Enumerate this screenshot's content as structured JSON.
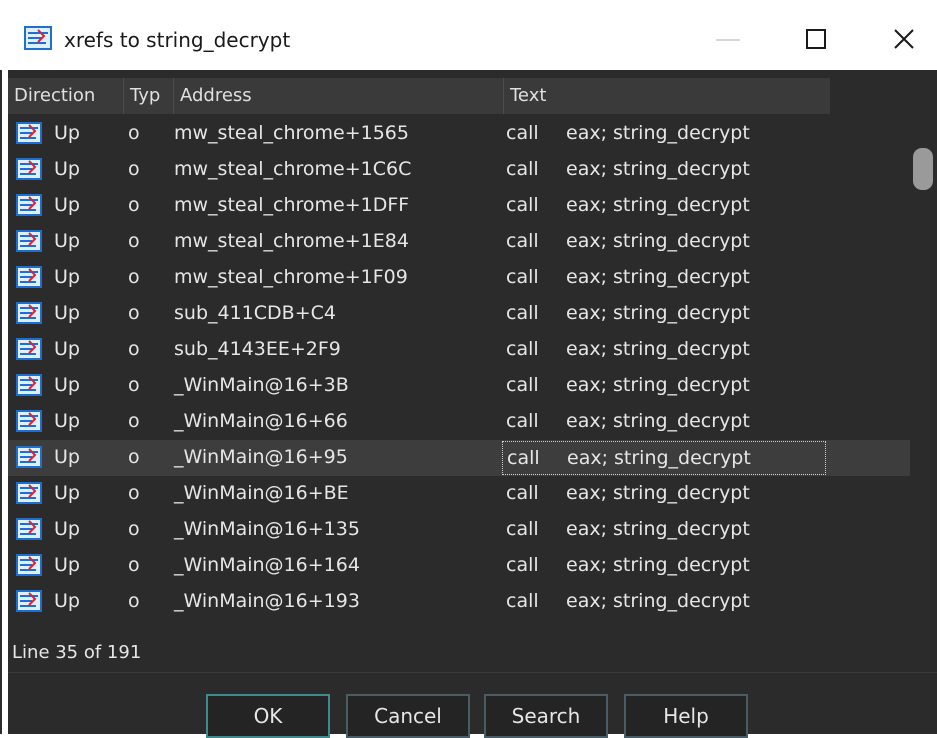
{
  "window": {
    "title": "xrefs to string_decrypt"
  },
  "columns": {
    "direction": "Direction",
    "type": "Typ",
    "address": "Address",
    "text": "Text"
  },
  "rows": [
    {
      "direction": "Up",
      "type": "o",
      "address": "mw_steal_chrome+1565",
      "mnemonic": "call",
      "operand": "eax; string_decrypt"
    },
    {
      "direction": "Up",
      "type": "o",
      "address": "mw_steal_chrome+1C6C",
      "mnemonic": "call",
      "operand": "eax; string_decrypt"
    },
    {
      "direction": "Up",
      "type": "o",
      "address": "mw_steal_chrome+1DFF",
      "mnemonic": "call",
      "operand": "eax; string_decrypt"
    },
    {
      "direction": "Up",
      "type": "o",
      "address": "mw_steal_chrome+1E84",
      "mnemonic": "call",
      "operand": "eax; string_decrypt"
    },
    {
      "direction": "Up",
      "type": "o",
      "address": "mw_steal_chrome+1F09",
      "mnemonic": "call",
      "operand": "eax; string_decrypt"
    },
    {
      "direction": "Up",
      "type": "o",
      "address": "sub_411CDB+C4",
      "mnemonic": "call",
      "operand": "eax; string_decrypt"
    },
    {
      "direction": "Up",
      "type": "o",
      "address": "sub_4143EE+2F9",
      "mnemonic": "call",
      "operand": "eax; string_decrypt"
    },
    {
      "direction": "Up",
      "type": "o",
      "address": "_WinMain@16+3B",
      "mnemonic": "call",
      "operand": "eax; string_decrypt"
    },
    {
      "direction": "Up",
      "type": "o",
      "address": "_WinMain@16+66",
      "mnemonic": "call",
      "operand": "eax; string_decrypt"
    },
    {
      "direction": "Up",
      "type": "o",
      "address": "_WinMain@16+95",
      "mnemonic": "call",
      "operand": "eax; string_decrypt",
      "selected": true
    },
    {
      "direction": "Up",
      "type": "o",
      "address": "_WinMain@16+BE",
      "mnemonic": "call",
      "operand": "eax; string_decrypt"
    },
    {
      "direction": "Up",
      "type": "o",
      "address": "_WinMain@16+135",
      "mnemonic": "call",
      "operand": "eax; string_decrypt"
    },
    {
      "direction": "Up",
      "type": "o",
      "address": "_WinMain@16+164",
      "mnemonic": "call",
      "operand": "eax; string_decrypt"
    },
    {
      "direction": "Up",
      "type": "o",
      "address": "_WinMain@16+193",
      "mnemonic": "call",
      "operand": "eax; string_decrypt"
    }
  ],
  "status": {
    "text": "Line 35 of 191"
  },
  "buttons": {
    "ok": "OK",
    "cancel": "Cancel",
    "search": "Search",
    "help": "Help"
  },
  "colors": {
    "background": "#2b2b2b",
    "header": "#3a3a3a",
    "selected_row": "#3d3d3d",
    "text": "#e6e6e6",
    "ok_border": "#3f8a8e"
  }
}
